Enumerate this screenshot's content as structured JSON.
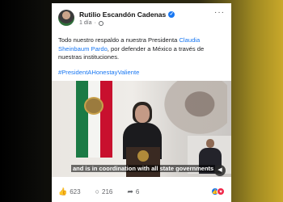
{
  "post": {
    "author": "Rutilio Escandón Cadenas",
    "time": "1 día",
    "more": "···",
    "text_before": "Todo nuestro respaldo a nuestra Presidenta ",
    "text_link": "Claudia Sheinbaum Pardo",
    "text_after": ", por defender a México a través de nuestras instituciones.",
    "hashtag": "#PresidentAHonestayValiente"
  },
  "video": {
    "caption": "and is in coordination with all state governments"
  },
  "footer": {
    "likes": "623",
    "comments": "216",
    "shares": "6"
  },
  "icons": [
    "verified-badge-icon",
    "globe-icon",
    "more-options-icon",
    "sound-icon",
    "like-icon",
    "comment-icon",
    "share-icon",
    "like-reaction-icon",
    "love-reaction-icon"
  ],
  "colors": {
    "link": "#1877f2",
    "text": "#1c1e21",
    "meta": "#65676b"
  }
}
